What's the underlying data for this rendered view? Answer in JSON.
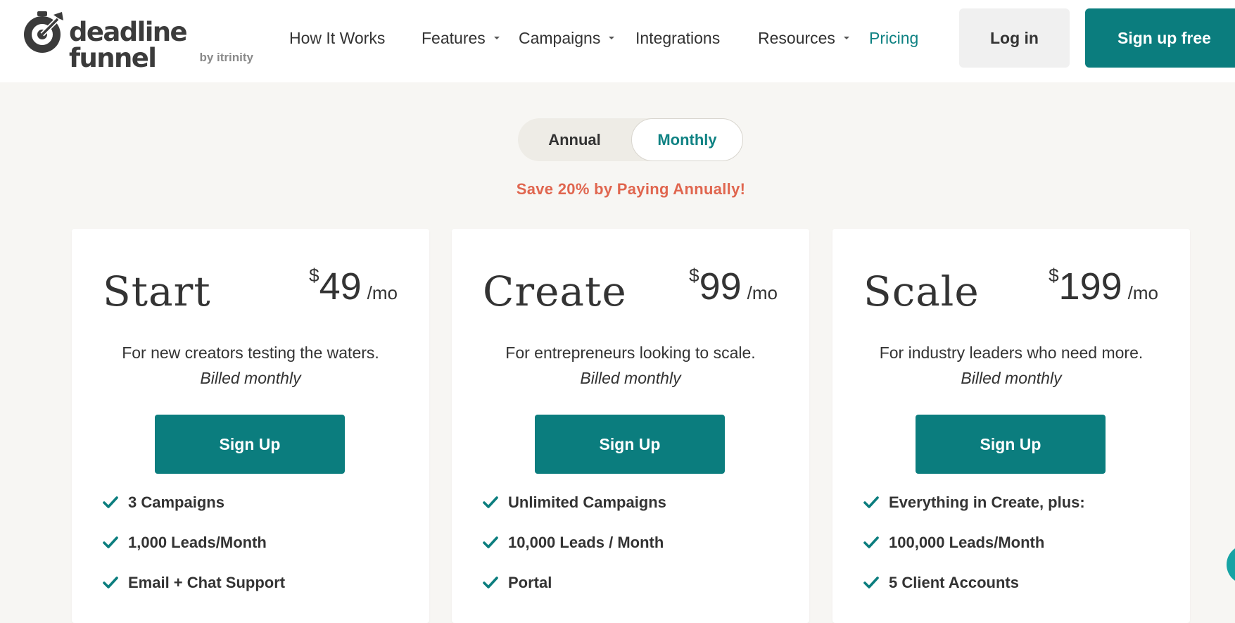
{
  "header": {
    "logo": {
      "wordmark": "deadline funnel",
      "byline": "by itrinity"
    },
    "nav": [
      {
        "label": "How It Works",
        "dropdown": false,
        "active": false
      },
      {
        "label": "Features",
        "dropdown": true,
        "active": false
      },
      {
        "label": "Campaigns",
        "dropdown": true,
        "active": false
      },
      {
        "label": "Integrations",
        "dropdown": false,
        "active": false
      },
      {
        "label": "Resources",
        "dropdown": true,
        "active": false
      },
      {
        "label": "Pricing",
        "dropdown": false,
        "active": true
      }
    ],
    "login_label": "Log in",
    "signup_label": "Sign up free"
  },
  "billing_toggle": {
    "options": [
      "Annual",
      "Monthly"
    ],
    "selected": "Monthly"
  },
  "save_note": "Save 20% by Paying Annually!",
  "plans": [
    {
      "name": "Start",
      "currency": "$",
      "price": "49",
      "period": "/mo",
      "description": "For new creators testing the waters.",
      "billing": "Billed monthly",
      "button_label": "Sign Up",
      "features": [
        "3 Campaigns",
        "1,000 Leads/Month",
        "Email + Chat Support"
      ]
    },
    {
      "name": "Create",
      "currency": "$",
      "price": "99",
      "period": "/mo",
      "description": "For entrepreneurs looking to scale.",
      "billing": "Billed monthly",
      "button_label": "Sign Up",
      "features": [
        "Unlimited Campaigns",
        "10,000 Leads / Month",
        "Portal"
      ]
    },
    {
      "name": "Scale",
      "currency": "$",
      "price": "199",
      "period": "/mo",
      "description": "For industry leaders who need more.",
      "billing": "Billed monthly",
      "button_label": "Sign Up",
      "features": [
        "Everything in Create, plus:",
        "100,000 Leads/Month",
        "5 Client Accounts"
      ]
    }
  ],
  "colors": {
    "brand_teal": "#0b7d7e",
    "accent_teal_text": "#0f8283",
    "save_note": "#e0664f",
    "page_background": "#f7f6f3"
  },
  "icons": [
    "deadline-funnel-logo-icon",
    "chevron-down-icon",
    "checkmark-icon",
    "chat-icon"
  ]
}
